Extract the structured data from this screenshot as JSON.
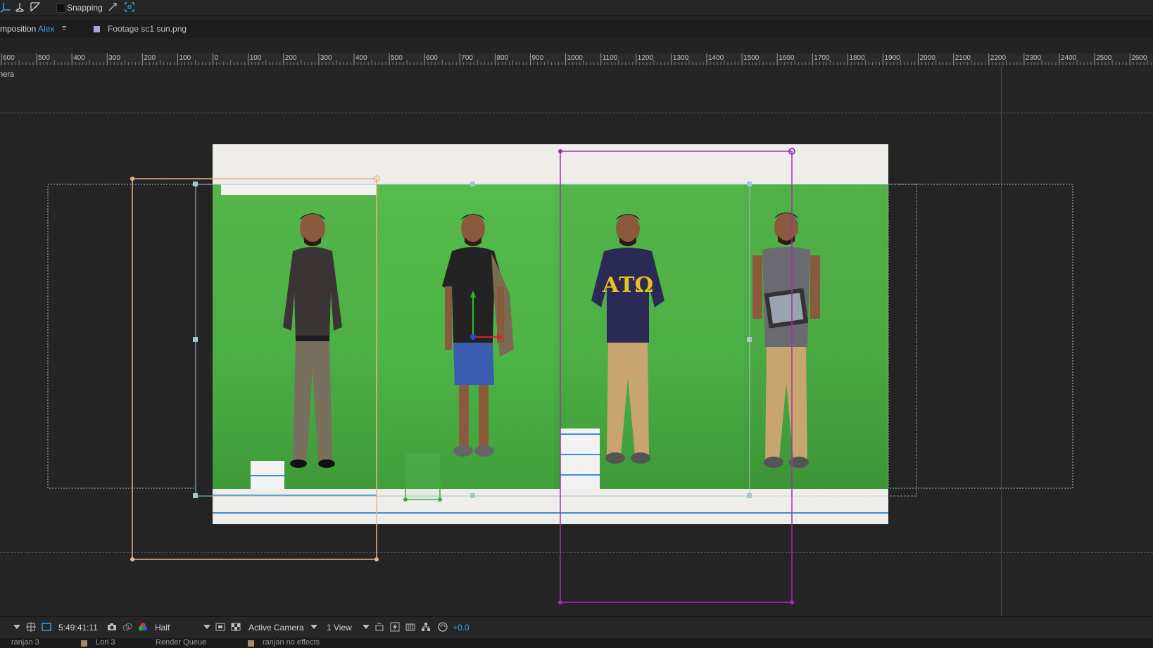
{
  "toolbar": {
    "snapping_label": "Snapping",
    "icons": [
      "axis-tool-icon",
      "world-axis-icon",
      "view-axis-icon",
      "snap-feather-icon",
      "snap-expand-icon"
    ]
  },
  "tabs": {
    "composition_prefix": "mposition",
    "composition_name": "Alex",
    "menu_glyph": "≡",
    "footage_label": "Footage sc1 sun.png"
  },
  "ruler": {
    "labels": [
      "600",
      "500",
      "400",
      "300",
      "200",
      "100",
      "0",
      "100",
      "200",
      "300",
      "400",
      "500",
      "600",
      "700",
      "800",
      "900",
      "1000",
      "1100",
      "1200",
      "1300",
      "1400",
      "1500",
      "1600",
      "1700",
      "1800",
      "1900",
      "2000",
      "2100",
      "2200",
      "2300",
      "2400",
      "2500",
      "2600"
    ]
  },
  "viewer": {
    "view_label": "nera"
  },
  "bottom_bar": {
    "timecode": "5:49:41:11",
    "resolution": "Half",
    "camera": "Active Camera",
    "view_layout": "1 View",
    "exposure": "+0.0"
  },
  "bottom_tabs": [
    "ranjan 3",
    "Lori 3",
    "Render Queue",
    "ranjan no effects"
  ],
  "colors": {
    "accent_blue": "#3ba7e6",
    "layer_orange": "#e8b48a",
    "layer_purple": "#a030b0",
    "green_screen": "#4caf44",
    "handle_cyan": "#9fc8cf"
  }
}
